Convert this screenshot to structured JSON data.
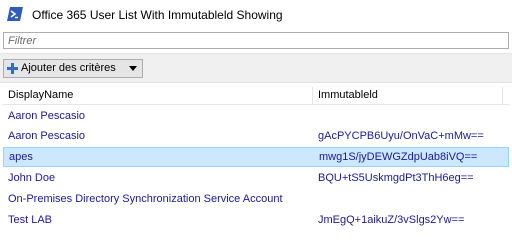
{
  "window": {
    "title": "Office 365 User List With Immutableld Showing"
  },
  "filter": {
    "placeholder": "Filtrer",
    "value": ""
  },
  "toolbar": {
    "criteria_label": "Ajouter des critères"
  },
  "grid": {
    "columns": [
      "DisplayName",
      "Immutableld"
    ],
    "rows": [
      {
        "name": "Aaron Pescasio",
        "id": ""
      },
      {
        "name": "Aaron Pescasio",
        "id": "gAcPYCPB6Uyu/OnVaC+mMw=="
      },
      {
        "name": "apes",
        "id": "mwg1S/jyDEWGZdpUab8iVQ=="
      },
      {
        "name": "John Doe",
        "id": "BQU+tS5UskmgdPt3ThH6eg=="
      },
      {
        "name": "On-Premises Directory Synchronization Service Account",
        "id": ""
      },
      {
        "name": "Test LAB",
        "id": "JmEgQ+1aikuZ/3vSlgs2Yw=="
      }
    ],
    "selected_row": 2
  },
  "colors": {
    "selection": "#cce8ff",
    "text": "#1a1a99",
    "toolbar": "#f0f0f0"
  }
}
